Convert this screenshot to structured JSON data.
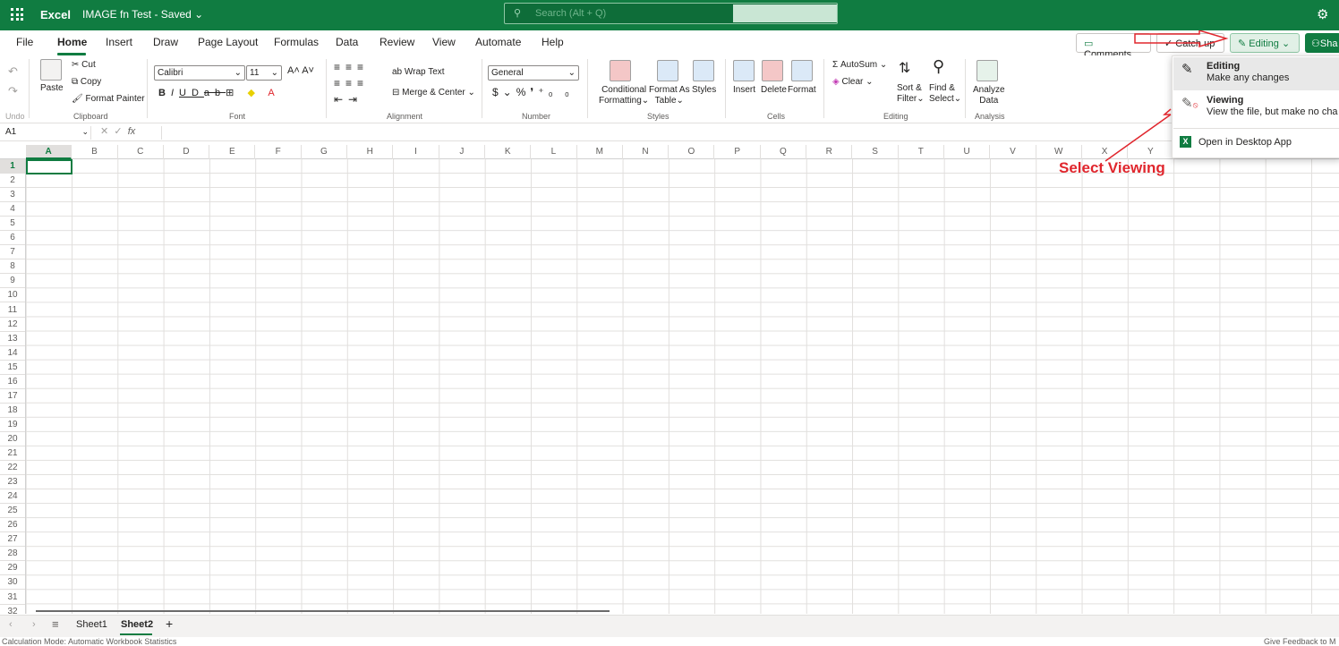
{
  "titlebar": {
    "app_name": "Excel",
    "doc_title": "IMAGE fn Test  -  Saved ⌄",
    "search_placeholder": "Search (Alt + Q)",
    "accent": "#107c41"
  },
  "menu": {
    "tabs": [
      "File",
      "Home",
      "Insert",
      "Draw",
      "Page Layout",
      "Formulas",
      "Data",
      "Review",
      "View",
      "Automate",
      "Help"
    ],
    "active": "Home"
  },
  "topbuttons": {
    "comments": "Comments",
    "catchup": "Catch up",
    "editing": "Editing",
    "share": "Sha"
  },
  "ribbon": {
    "undo_label": "Undo",
    "clipboard": {
      "paste": "Paste",
      "cut": "Cut",
      "copy": "Copy",
      "format_painter": "Format Painter",
      "label": "Clipboard"
    },
    "font": {
      "name": "Calibri",
      "size": "11",
      "label": "Font"
    },
    "alignment": {
      "wrap": "Wrap Text",
      "merge": "Merge & Center",
      "label": "Alignment"
    },
    "number": {
      "format": "General",
      "label": "Number"
    },
    "styles": {
      "conditional": "Conditional",
      "conditional2": "Formatting",
      "format_as": "Format As",
      "format_as2": "Table",
      "styles": "Styles",
      "label": "Styles"
    },
    "cells": {
      "insert": "Insert",
      "delete": "Delete",
      "format": "Format",
      "label": "Cells"
    },
    "editing": {
      "autosum": "AutoSum",
      "clear": "Clear",
      "sort": "Sort &",
      "sort2": "Filter",
      "find": "Find &",
      "find2": "Select",
      "label": "Editing"
    },
    "analysis": {
      "analyze": "Analyze",
      "analyze2": "Data",
      "label": "Analysis"
    }
  },
  "formula": {
    "namebox": "A1",
    "fx": "fx"
  },
  "grid": {
    "columns": [
      "A",
      "B",
      "C",
      "D",
      "E",
      "F",
      "G",
      "H",
      "I",
      "J",
      "K",
      "L",
      "M",
      "N",
      "O",
      "P",
      "Q",
      "R",
      "S",
      "T",
      "U",
      "V",
      "W",
      "X",
      "Y"
    ],
    "rows": [
      "1",
      "2",
      "3",
      "4",
      "5",
      "6",
      "7",
      "8",
      "9",
      "10",
      "11",
      "12",
      "13",
      "14",
      "15",
      "16",
      "17",
      "18",
      "19",
      "20",
      "21",
      "22",
      "23",
      "24",
      "25",
      "26",
      "27",
      "28",
      "29",
      "30",
      "31",
      "32"
    ],
    "selected": "A1"
  },
  "sheets": {
    "tabs": [
      "Sheet1",
      "Sheet2"
    ],
    "active": "Sheet2",
    "add": "+"
  },
  "status": {
    "left": "Calculation Mode: Automatic   Workbook Statistics",
    "right": "Give Feedback to M"
  },
  "dropdown": {
    "editing_title": "Editing",
    "editing_desc": "Make any changes",
    "viewing_title": "Viewing",
    "viewing_desc": "View the file, but make no cha",
    "desktop": "Open in Desktop App"
  },
  "annotation": {
    "text": "Select Viewing",
    "color": "#e0262d"
  }
}
